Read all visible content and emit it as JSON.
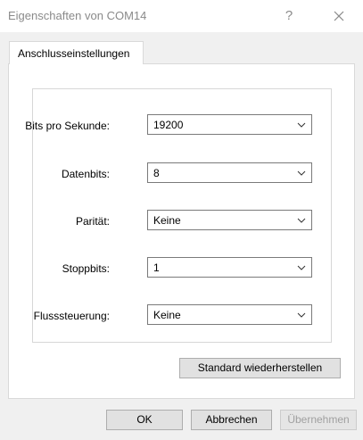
{
  "window": {
    "title": "Eigenschaften von COM14",
    "help_label": "?"
  },
  "tabs": [
    {
      "label": "Anschlusseinstellungen"
    }
  ],
  "settings": {
    "rows": [
      {
        "label": "Bits pro Sekunde:",
        "value": "19200"
      },
      {
        "label": "Datenbits:",
        "value": "8"
      },
      {
        "label": "Parität:",
        "value": "Keine"
      },
      {
        "label": "Stoppbits:",
        "value": "1"
      },
      {
        "label": "Flusssteuerung:",
        "value": "Keine"
      }
    ],
    "restore_defaults_label": "Standard wiederherstellen"
  },
  "footer": {
    "ok_label": "OK",
    "cancel_label": "Abbrechen",
    "apply_label": "Übernehmen"
  },
  "colors": {
    "title_text": "#8a8a8a",
    "dialog_background": "#f0f0f0",
    "disabled_text": "#a0a0a0"
  }
}
